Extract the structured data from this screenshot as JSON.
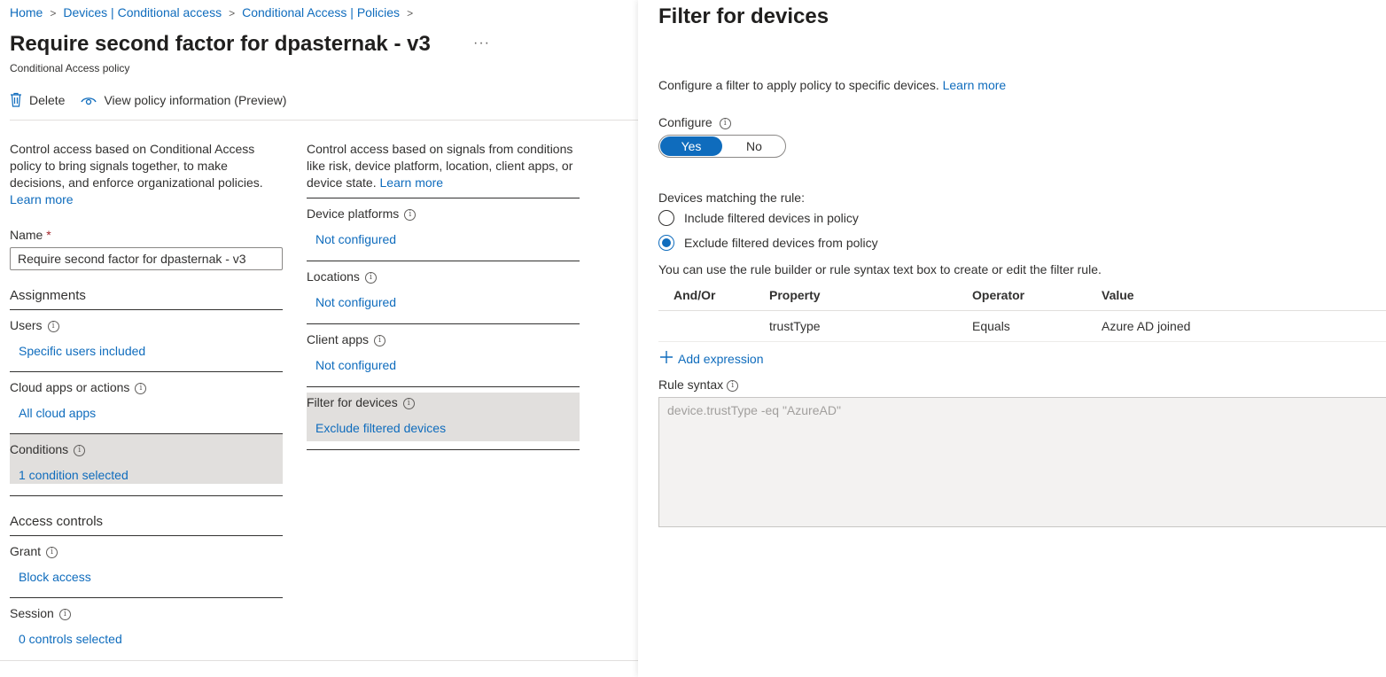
{
  "breadcrumb": [
    "Home",
    "Devices | Conditional access",
    "Conditional Access | Policies"
  ],
  "header": {
    "title": "Require second factor for dpasternak - v3",
    "more": "···",
    "subtitle": "Conditional Access policy"
  },
  "toolbar": {
    "delete_label": "Delete",
    "view_info_label": "View policy information (Preview)"
  },
  "left": {
    "description": "Control access based on Conditional Access policy to bring signals together, to make decisions, and enforce organizational policies.",
    "learn_more": "Learn more",
    "name_label": "Name",
    "name_required": "*",
    "name_value": "Require second factor for dpasternak - v3",
    "assignments_header": "Assignments",
    "assignments": [
      {
        "label": "Users",
        "value": "Specific users included"
      },
      {
        "label": "Cloud apps or actions",
        "value": "All cloud apps"
      },
      {
        "label": "Conditions",
        "value": "1 condition selected",
        "selected": true
      }
    ],
    "access_controls_header": "Access controls",
    "access_controls": [
      {
        "label": "Grant",
        "value": "Block access"
      },
      {
        "label": "Session",
        "value": "0 controls selected"
      }
    ]
  },
  "conditions": {
    "description": "Control access based on signals from conditions like risk, device platform, location, client apps, or device state.",
    "learn_more": "Learn more",
    "items": [
      {
        "label": "Device platforms",
        "value": "Not configured"
      },
      {
        "label": "Locations",
        "value": "Not configured"
      },
      {
        "label": "Client apps",
        "value": "Not configured"
      },
      {
        "label": "Filter for devices",
        "value": "Exclude filtered devices",
        "selected": true
      }
    ]
  },
  "panel": {
    "title": "Filter for devices",
    "description": "Configure a filter to apply policy to specific devices.",
    "learn_more": "Learn more",
    "configure_label": "Configure",
    "toggle_yes": "Yes",
    "toggle_no": "No",
    "matching_label": "Devices matching the rule:",
    "radio_include": "Include filtered devices in policy",
    "radio_exclude": "Exclude filtered devices from policy",
    "help_text": "You can use the rule builder or rule syntax text box to create or edit the filter rule.",
    "table_headers": [
      "And/Or",
      "Property",
      "Operator",
      "Value"
    ],
    "rows": [
      {
        "andor": "",
        "property": "trustType",
        "operator": "Equals",
        "value": "Azure AD joined"
      }
    ],
    "add_expression": "Add expression",
    "rule_syntax_label": "Rule syntax",
    "rule_syntax_value": "device.trustType -eq \"AzureAD\""
  },
  "colors": {
    "accent": "#0f6cbd",
    "selected_bg": "#e1dfdd",
    "text": "#323130"
  }
}
